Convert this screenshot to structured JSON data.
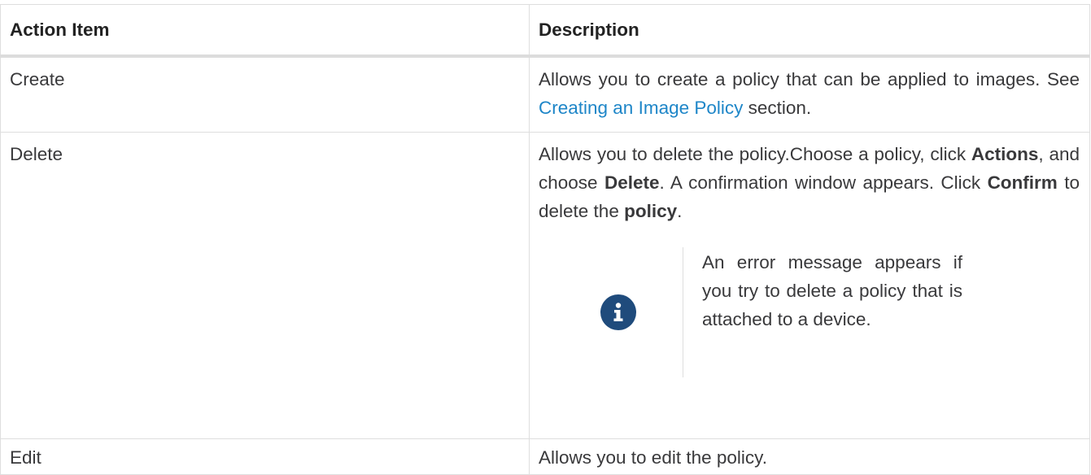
{
  "table": {
    "headers": [
      "Action Item",
      "Description"
    ],
    "rows": {
      "create": {
        "action": "Create",
        "desc_before": "Allows you to create a policy that can be applied to images. See ",
        "link_text": "Creating an Image Policy",
        "desc_after": " section."
      },
      "delete": {
        "action": "Delete",
        "desc_1": "Allows you to delete the policy.Choose a policy, click ",
        "bold_actions": "Actions",
        "desc_2": ", and choose ",
        "bold_delete": "Delete",
        "desc_3": ". A confirmation window appears. Click ",
        "bold_confirm": "Confirm",
        "desc_4": " to delete the ",
        "bold_policy": "policy",
        "desc_5": ".",
        "note_icon": "info-icon",
        "note_text": "An error message appears if you try to delete a policy that is attached to a device."
      },
      "edit": {
        "action": "Edit",
        "desc": "Allows you to edit the policy."
      }
    }
  },
  "colors": {
    "link": "#1e86c8",
    "note_icon_bg": "#1f4b7c",
    "border": "#dedede"
  }
}
